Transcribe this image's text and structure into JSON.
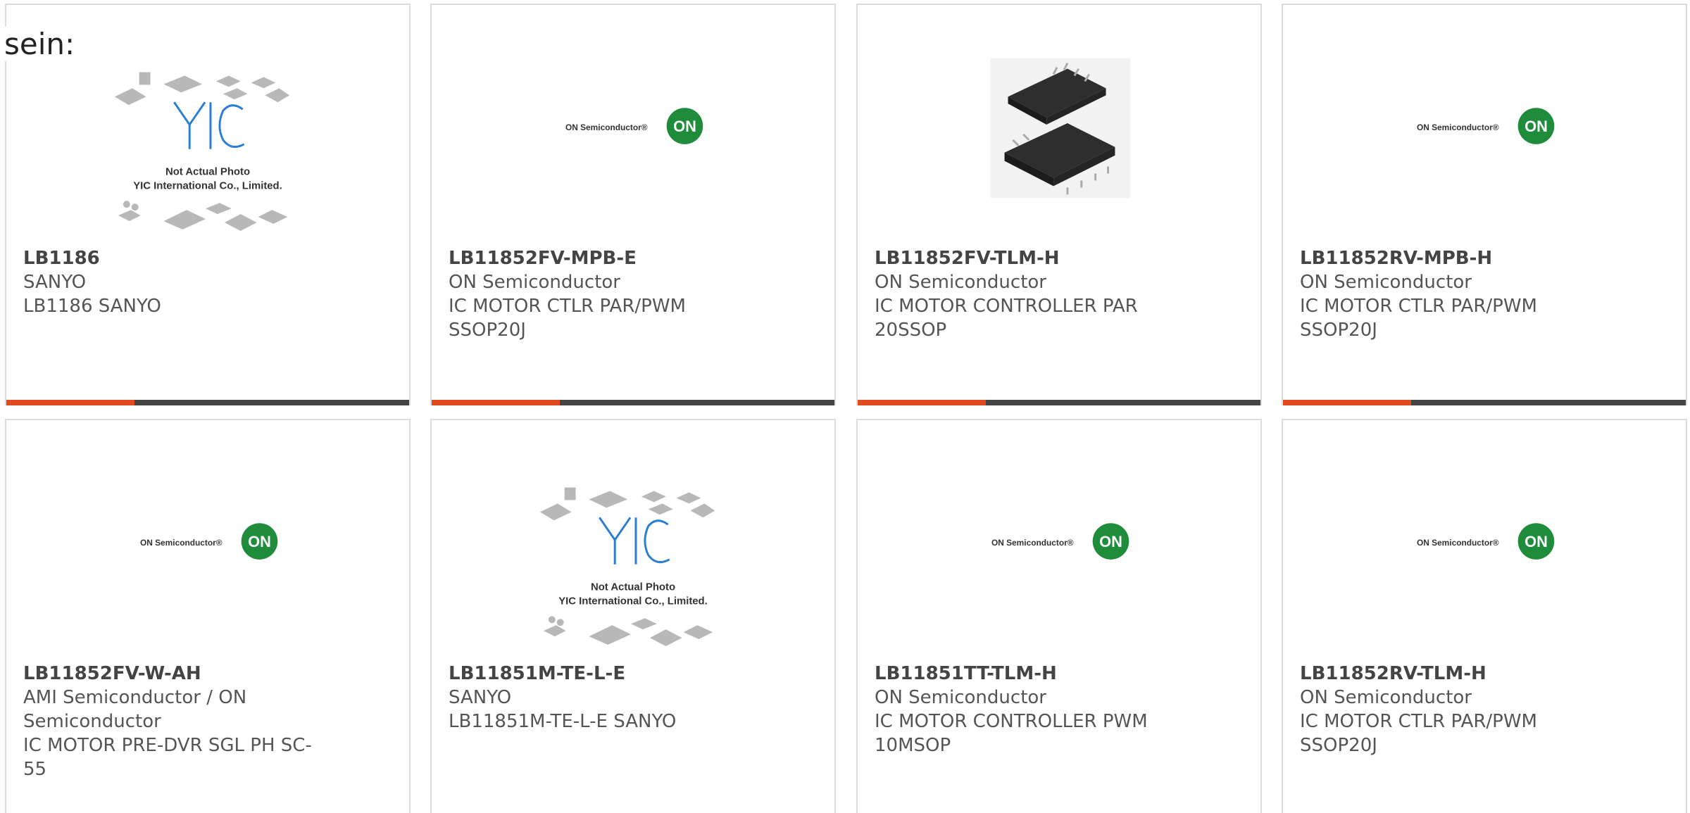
{
  "heading": "sein:",
  "products": [
    {
      "part": "LB1186",
      "maker": "SANYO",
      "desc": [
        "LB1186 SANYO"
      ],
      "image": "yic-placeholder",
      "photo_note": [
        "Not Actual Photo",
        "YIC International Co., Limited."
      ]
    },
    {
      "part": "LB11852FV-MPB-E",
      "maker": "ON Semiconductor",
      "desc": [
        "IC MOTOR CTLR PAR/PWM",
        "SSOP20J"
      ],
      "image": "on-semi-logo",
      "logo_text": "ON Semiconductor®",
      "logo_badge": "ON"
    },
    {
      "part": "LB11852FV-TLM-H",
      "maker": "ON Semiconductor",
      "desc": [
        "IC MOTOR CONTROLLER PAR",
        "20SSOP"
      ],
      "image": "ssop-chip-photo"
    },
    {
      "part": "LB11852RV-MPB-H",
      "maker": "ON Semiconductor",
      "desc": [
        "IC MOTOR CTLR PAR/PWM",
        "SSOP20J"
      ],
      "image": "on-semi-logo",
      "logo_text": "ON Semiconductor®",
      "logo_badge": "ON"
    },
    {
      "part": "LB11852FV-W-AH",
      "maker": "AMI Semiconductor / ON",
      "maker2": "Semiconductor",
      "desc": [
        "IC MOTOR PRE-DVR SGL PH SC-",
        "55"
      ],
      "image": "on-semi-logo",
      "logo_text": "ON Semiconductor®",
      "logo_badge": "ON"
    },
    {
      "part": "LB11851M-TE-L-E",
      "maker": "SANYO",
      "desc": [
        "LB11851M-TE-L-E SANYO"
      ],
      "image": "yic-placeholder",
      "photo_note": [
        "Not Actual Photo",
        "YIC International Co., Limited."
      ]
    },
    {
      "part": "LB11851TT-TLM-H",
      "maker": "ON Semiconductor",
      "desc": [
        "IC MOTOR CONTROLLER PWM",
        "10MSOP"
      ],
      "image": "on-semi-logo",
      "logo_text": "ON Semiconductor®",
      "logo_badge": "ON"
    },
    {
      "part": "LB11852RV-TLM-H",
      "maker": "ON Semiconductor",
      "desc": [
        "IC MOTOR CTLR PAR/PWM",
        "SSOP20J"
      ],
      "image": "on-semi-logo",
      "logo_text": "ON Semiconductor®",
      "logo_badge": "ON"
    }
  ],
  "colors": {
    "accent": "#e04a1f",
    "bar": "#444444",
    "border": "#dcdcdc",
    "on_green": "#1e8c3a",
    "yic_blue": "#2a7fd4"
  }
}
